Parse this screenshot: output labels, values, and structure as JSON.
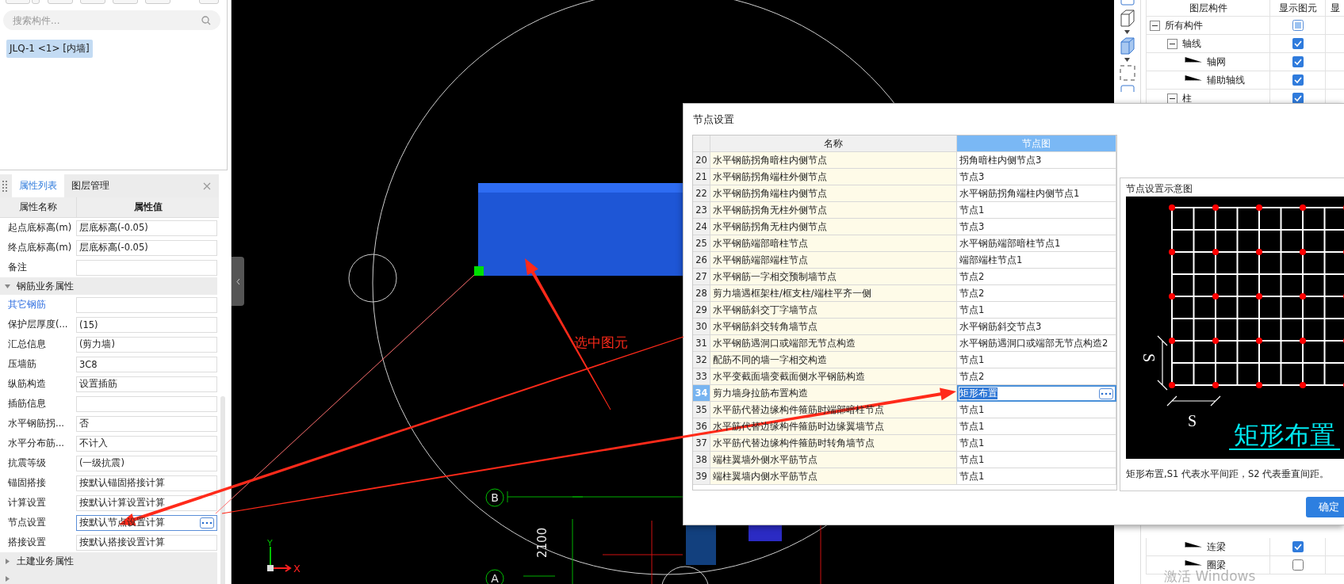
{
  "left_panel": {
    "search": {
      "placeholder": "搜索构件..."
    },
    "components": [
      {
        "label": "JLQ-1 <1> [内墙]",
        "selected": true
      }
    ],
    "properties": {
      "tabs": [
        {
          "label": "属性列表",
          "selected": true
        },
        {
          "label": "图层管理",
          "selected": false
        }
      ],
      "columns": [
        "属性名称",
        "属性值"
      ],
      "rows": [
        {
          "kind": "field",
          "label": "起点底标高(m)",
          "value": "层底标高(-0.05)",
          "selected": false
        },
        {
          "kind": "field",
          "label": "终点底标高(m)",
          "value": "层底标高(-0.05)",
          "selected": false
        },
        {
          "kind": "field",
          "label": "备注",
          "selected": false
        },
        {
          "kind": "group",
          "label": "钢筋业务属性",
          "expanded": true
        },
        {
          "kind": "link",
          "label": "其它钢筋",
          "selected": false
        },
        {
          "kind": "field",
          "label": "保护层厚度(...",
          "value": "(15)",
          "selected": false
        },
        {
          "kind": "field",
          "label": "汇总信息",
          "value": "(剪力墙)",
          "selected": false
        },
        {
          "kind": "field",
          "label": "压墙筋",
          "value": "3C8",
          "selected": false
        },
        {
          "kind": "field",
          "label": "纵筋构造",
          "value": "设置插筋",
          "selected": false
        },
        {
          "kind": "field",
          "label": "插筋信息",
          "selected": false
        },
        {
          "kind": "field",
          "label": "水平钢筋拐...",
          "value": "否",
          "selected": false
        },
        {
          "kind": "field",
          "label": "水平分布筋...",
          "value": "不计入",
          "selected": false
        },
        {
          "kind": "field",
          "label": "抗震等级",
          "value": "(一级抗震)",
          "selected": false
        },
        {
          "kind": "field",
          "label": "锚固搭接",
          "value": "按默认锚固搭接计算",
          "selected": false
        },
        {
          "kind": "field",
          "label": "计算设置",
          "value": "按默认计算设置计算",
          "selected": false
        },
        {
          "kind": "field",
          "label": "节点设置",
          "value": "按默认节点设置计算",
          "selected": true
        },
        {
          "kind": "field",
          "label": "搭接设置",
          "value": "按默认搭接设置计算",
          "selected": false
        },
        {
          "kind": "group",
          "label": "土建业务属性",
          "expanded": false
        },
        {
          "kind": "group",
          "expanded": false
        }
      ]
    }
  },
  "canvas": {
    "annotation": "选中图元",
    "axis_markers": [
      {
        "label": "B"
      },
      {
        "label": "A"
      }
    ],
    "dimension": "2100",
    "ucs": {
      "y": "Y",
      "x": "X"
    }
  },
  "dialog": {
    "title": "节点设置",
    "table": {
      "columns": [
        {
          "label": "名称",
          "selected": false
        },
        {
          "label": "节点图",
          "selected": true
        }
      ],
      "rows": [
        {
          "index": "20",
          "name": "水平钢筋拐角暗柱内侧节点",
          "value": "拐角暗柱内侧节点3",
          "selected": false
        },
        {
          "index": "21",
          "name": "水平钢筋拐角端柱外侧节点",
          "value": "节点3",
          "selected": false
        },
        {
          "index": "22",
          "name": "水平钢筋拐角端柱内侧节点",
          "value": "水平钢筋拐角端柱内侧节点1",
          "selected": false
        },
        {
          "index": "23",
          "name": "水平钢筋拐角无柱外侧节点",
          "value": "节点1",
          "selected": false
        },
        {
          "index": "24",
          "name": "水平钢筋拐角无柱内侧节点",
          "value": "节点3",
          "selected": false
        },
        {
          "index": "25",
          "name": "水平钢筋端部暗柱节点",
          "value": "水平钢筋端部暗柱节点1",
          "selected": false
        },
        {
          "index": "26",
          "name": "水平钢筋端部端柱节点",
          "value": "端部端柱节点1",
          "selected": false
        },
        {
          "index": "27",
          "name": "水平钢筋一字相交预制墙节点",
          "value": "节点2",
          "selected": false
        },
        {
          "index": "28",
          "name": "剪力墙遇框架柱/框支柱/端柱平齐一侧",
          "value": "节点2",
          "selected": false
        },
        {
          "index": "29",
          "name": "水平钢筋斜交丁字墙节点",
          "value": "节点1",
          "selected": false
        },
        {
          "index": "30",
          "name": "水平钢筋斜交转角墙节点",
          "value": "水平钢筋斜交节点3",
          "selected": false
        },
        {
          "index": "31",
          "name": "水平钢筋遇洞口或端部无节点构造",
          "value": "水平钢筋遇洞口或端部无节点构造2",
          "selected": false
        },
        {
          "index": "32",
          "name": "配筋不同的墙一字相交构造",
          "value": "节点1",
          "selected": false
        },
        {
          "index": "33",
          "name": "水平变截面墙变截面侧水平钢筋构造",
          "value": "节点2",
          "selected": false
        },
        {
          "index": "34",
          "name": "剪力墙身拉筋布置构造",
          "value": "矩形布置",
          "selected": true
        },
        {
          "index": "35",
          "name": "水平筋代替边缘构件箍筋时端部暗柱节点",
          "value": "节点1",
          "selected": false
        },
        {
          "index": "36",
          "name": "水平筋代替边缘构件箍筋时边缘翼墙节点",
          "value": "节点1",
          "selected": false
        },
        {
          "index": "37",
          "name": "水平筋代替边缘构件箍筋时转角墙节点",
          "value": "节点1",
          "selected": false
        },
        {
          "index": "38",
          "name": "端柱翼墙外侧水平筋节点",
          "value": "节点1",
          "selected": false
        },
        {
          "index": "39",
          "name": "端柱翼墙内侧水平筋节点",
          "value": "节点1",
          "selected": false
        }
      ]
    },
    "preview": {
      "title": "节点设置示意图",
      "dimension_labels": [
        "S",
        "S"
      ],
      "drawing_label": "矩形布置",
      "description": "矩形布置,S1 代表水平间距，S2 代表垂直间距。"
    },
    "buttons": [
      {
        "label": "确定"
      }
    ]
  },
  "layer_panel": {
    "columns": [
      "图层构件",
      "显示图元",
      "显"
    ],
    "tree": [
      {
        "label": "所有构件",
        "expanded": true,
        "checked": true,
        "indeterminate": true,
        "children": [
          {
            "label": "轴线",
            "expanded": true,
            "checked": true,
            "indeterminate": false,
            "children": [
              {
                "label": "轴网",
                "expanded": false,
                "checked": true,
                "indeterminate": false
              },
              {
                "label": "辅助轴线",
                "expanded": false,
                "checked": true,
                "indeterminate": false
              }
            ]
          },
          {
            "label": "柱",
            "expanded": true,
            "checked": true,
            "indeterminate": false
          }
        ]
      }
    ],
    "lower_rows": [
      {
        "label": "连梁",
        "checked": true
      },
      {
        "label": "圈梁",
        "checked": false
      }
    ]
  },
  "os_notice": "激活 Windows"
}
